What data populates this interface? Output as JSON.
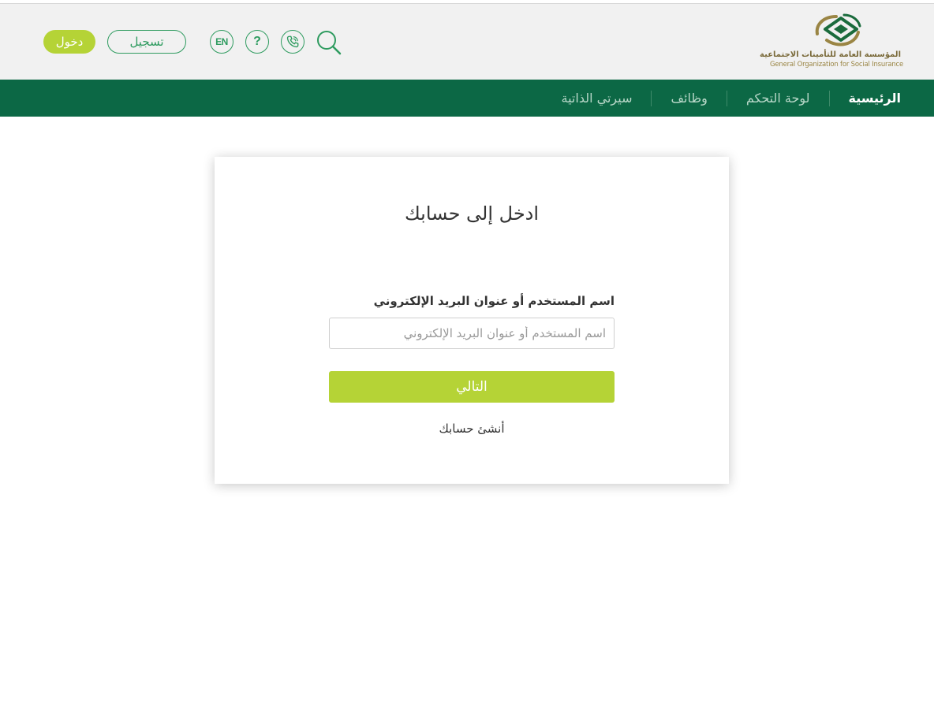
{
  "header": {
    "logo": {
      "name_ar": "المؤسسة العامة للتأمينات الاجتماعية",
      "name_en": "General Organization for Social Insurance"
    },
    "icons": {
      "search": "search-icon",
      "phone": "phone-icon",
      "help": "?",
      "language": "EN"
    },
    "register_label": "تسجيل",
    "login_label": "دخول"
  },
  "nav": {
    "items": [
      {
        "label": "الرئيسية",
        "active": true
      },
      {
        "label": "لوحة التحكم",
        "active": false
      },
      {
        "label": "وظائف",
        "active": false
      },
      {
        "label": "سيرتي الذاتية",
        "active": false
      }
    ]
  },
  "login": {
    "title": "ادخل إلى حسابك",
    "username_label": "اسم المستخدم أو عنوان البريد الإلكتروني",
    "username_placeholder": "اسم المستخدم أو عنوان البريد الإلكتروني",
    "username_value": "",
    "next_label": "التالي",
    "create_account_label": "أنشئ حسابك"
  },
  "colors": {
    "primary_green": "#0c6845",
    "accent_lime": "#b5d336",
    "icon_green": "#2e9b5f",
    "header_bg": "#f1f1f1",
    "logo_gold": "#9a8544"
  }
}
